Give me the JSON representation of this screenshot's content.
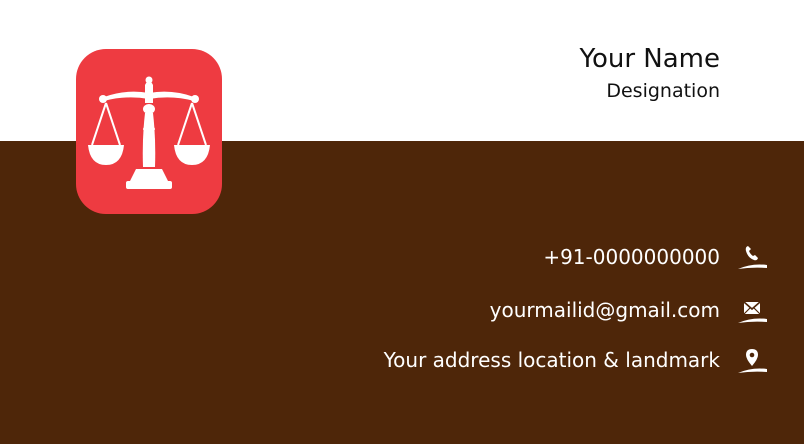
{
  "card": {
    "name": "Your Name",
    "designation": "Designation",
    "phone": "+91-0000000000",
    "email": "yourmailid@gmail.com",
    "address": "Your address location & landmark"
  },
  "logo": {
    "icon": "scales-of-justice-icon"
  },
  "icons": {
    "phone": "phone-icon",
    "email": "envelope-icon",
    "address": "location-pin-icon"
  },
  "colors": {
    "band": "#4e2609",
    "logo_bg": "#ee3b41",
    "top": "#ffffff"
  }
}
